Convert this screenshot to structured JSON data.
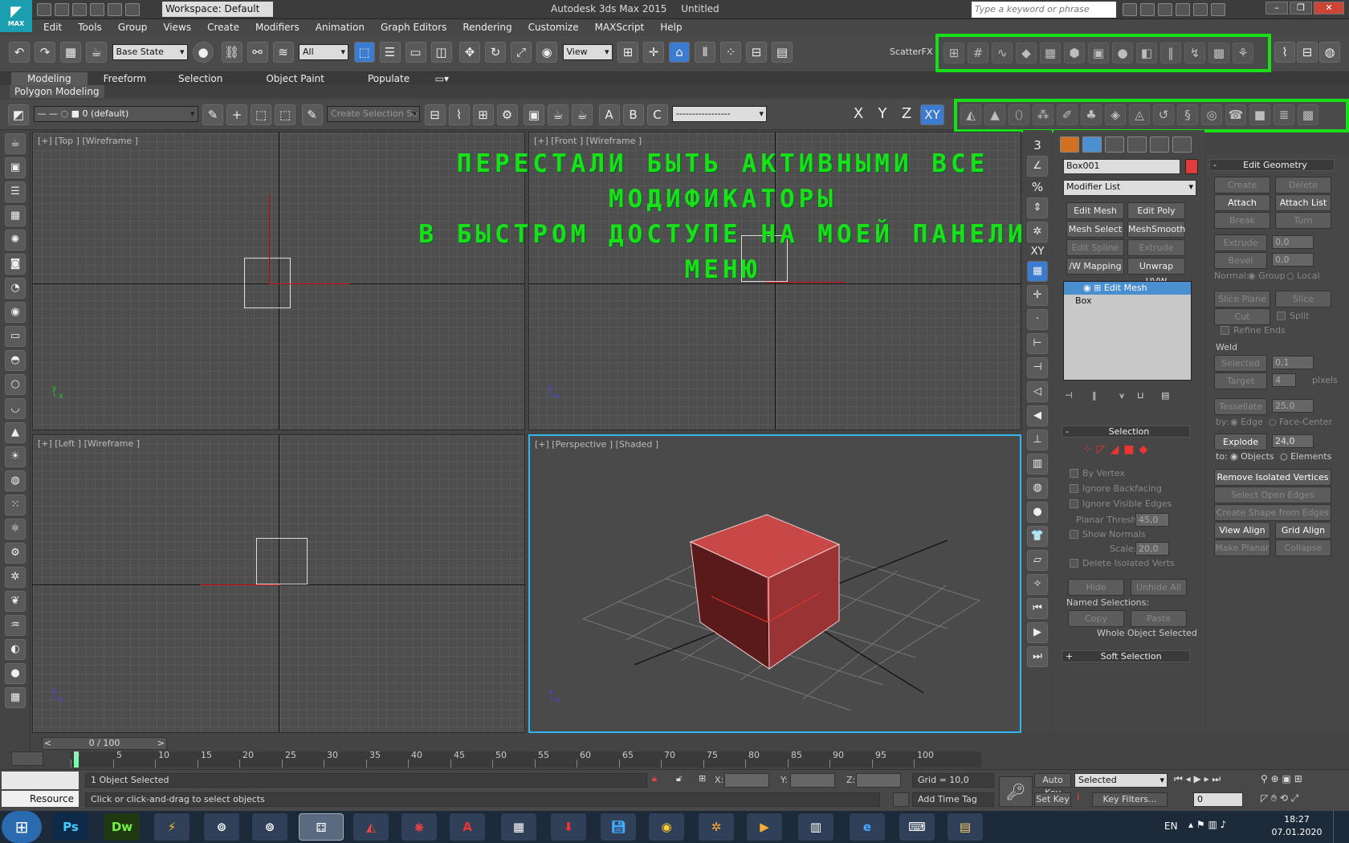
{
  "title_bar": {
    "app_title": "Autodesk 3ds Max  2015",
    "document": "Untitled",
    "workspace": "Workspace: Default",
    "search_placeholder": "Type a keyword or phrase",
    "logo_text": "MAX"
  },
  "menu": [
    "Edit",
    "Tools",
    "Group",
    "Views",
    "Create",
    "Modifiers",
    "Animation",
    "Graph Editors",
    "Rendering",
    "Customize",
    "MAXScript",
    "Help"
  ],
  "main_toolbar": {
    "state_set": "Base State",
    "selection_filter": "All",
    "ref_coord": "View",
    "scatterfx_label": "ScatterFX"
  },
  "ribbon": {
    "tabs": [
      "Modeling",
      "Freeform",
      "Selection",
      "Object Paint",
      "Populate"
    ],
    "active_tab": "Modeling",
    "sub_label": "Polygon Modeling"
  },
  "sub_toolbar": {
    "layer": "0 (default)",
    "named_selection_placeholder": "Create Selection Se",
    "axes": [
      "X",
      "Y",
      "Z",
      "XY"
    ]
  },
  "overlay_note": {
    "line1": "ПЕРЕСТАЛИ БЫТЬ АКТИВНЫМИ ВСЕ МОДИФИКАТОРЫ",
    "line2": "В БЫСТРОМ ДОСТУПЕ НА МОЕЙ ПАНЕЛИ МЕНЮ",
    "color": "#19e019"
  },
  "viewports": {
    "top": "[+] [Top ] [Wireframe ]",
    "front": "[+] [Front ] [Wireframe ]",
    "left": "[+] [Left ] [Wireframe ]",
    "perspective": "[+] [Perspective ] [Shaded ]"
  },
  "left_strip": {
    "numbers": [
      "3",
      "%",
      "XY"
    ]
  },
  "command_panel": {
    "object_name": "Box001",
    "object_color": "#e03c3c",
    "modifier_list": "Modifier List",
    "modifier_buttons": [
      "Edit Mesh",
      "Edit Poly",
      "Mesh Select",
      "MeshSmooth",
      "Edit Spline",
      "Extrude",
      "/W Mapping Ac",
      "Unwrap UVW"
    ],
    "stack": [
      "Edit Mesh",
      "Box"
    ],
    "selection_rollout": {
      "title": "Selection",
      "by_vertex": "By Vertex",
      "ignore_backfacing": "Ignore Backfacing",
      "ignore_visible_edges": "Ignore Visible Edges",
      "planar_thresh_label": "Planar Thresh:",
      "planar_thresh_value": "45,0",
      "show_normals": "Show Normals",
      "scale_label": "Scale:",
      "scale_value": "20,0",
      "delete_isolated_verts": "Delete Isolated Verts",
      "hide": "Hide",
      "unhide_all": "Unhide All",
      "named_selections": "Named Selections:",
      "copy": "Copy",
      "paste": "Paste",
      "status": "Whole Object Selected"
    },
    "soft_selection_rollout": "Soft Selection"
  },
  "edit_geometry": {
    "title": "Edit Geometry",
    "create": "Create",
    "delete": "Delete",
    "attach": "Attach",
    "attach_list": "Attach List",
    "break": "Break",
    "turn": "Turn",
    "extrude": "Extrude",
    "extrude_value": "0,0",
    "bevel": "Bevel",
    "bevel_value": "0,0",
    "normal_label": "Normal:",
    "group": "Group",
    "local": "Local",
    "slice_plane": "Slice Plane",
    "slice": "Slice",
    "cut": "Cut",
    "split": "Split",
    "refine_ends": "Refine Ends",
    "weld_label": "Weld",
    "selected": "Selected",
    "selected_value": "0,1",
    "target": "Target",
    "target_value": "4",
    "pixels": "pixels",
    "tessellate": "Tessellate",
    "tessellate_value": "25,0",
    "by_label": "by:",
    "edge": "Edge",
    "face_center": "Face-Center",
    "explode": "Explode",
    "explode_value": "24,0",
    "to_label": "to:",
    "objects": "Objects",
    "elements": "Elements",
    "remove_isolated_vertices": "Remove Isolated Vertices",
    "select_open_edges": "Select Open Edges",
    "create_shape_from_edges": "Create Shape from Edges",
    "view_align": "View Align",
    "grid_align": "Grid Align",
    "make_planar": "Make Planar",
    "collapse": "Collapse"
  },
  "timeline": {
    "frame_counter": "0 / 100",
    "ticks": [
      "0",
      "5",
      "10",
      "15",
      "20",
      "25",
      "30",
      "35",
      "40",
      "45",
      "50",
      "55",
      "60",
      "65",
      "70",
      "75",
      "80",
      "85",
      "90",
      "95",
      "100"
    ]
  },
  "status": {
    "resource": "Resource",
    "selected_msg": "1 Object Selected",
    "prompt": "Click or click-and-drag to select objects",
    "x_label": "X:",
    "y_label": "Y:",
    "z_label": "Z:",
    "grid": "Grid = 10,0",
    "add_time_tag": "Add Time Tag",
    "auto_key": "Auto Key",
    "set_key": "Set Key",
    "key_mode": "Selected",
    "key_filters": "Key Filters...",
    "frame_value": "0"
  },
  "taskbar": {
    "apps": [
      "Ps",
      "Dw"
    ],
    "lang": "EN",
    "time": "18:27",
    "date": "07.01.2020"
  }
}
